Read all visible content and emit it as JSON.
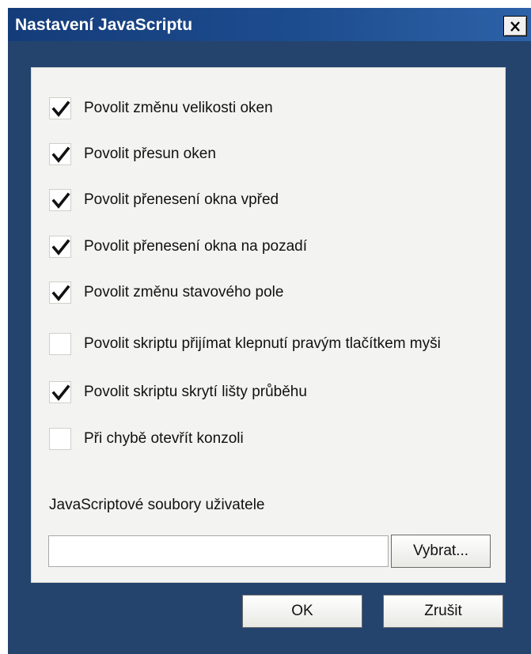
{
  "window": {
    "title": "Nastavení JavaScriptu"
  },
  "options": [
    {
      "label": "Povolit změnu velikosti oken",
      "checked": true
    },
    {
      "label": "Povolit přesun oken",
      "checked": true
    },
    {
      "label": "Povolit přenesení okna vpřed",
      "checked": true
    },
    {
      "label": "Povolit přenesení okna na pozadí",
      "checked": true
    },
    {
      "label": "Povolit změnu stavového pole",
      "checked": true
    },
    {
      "label": "Povolit skriptu přijímat klepnutí pravým tlačítkem myši",
      "checked": false
    },
    {
      "label": "Povolit skriptu skrytí lišty průběhu",
      "checked": true
    },
    {
      "label": "Při chybě otevřít konzoli",
      "checked": false
    }
  ],
  "files": {
    "label": "JavaScriptové soubory uživatele",
    "value": "",
    "button": "Vybrat..."
  },
  "buttons": {
    "ok": "OK",
    "cancel": "Zrušit"
  },
  "colors": {
    "title_bar": "#1d4c8e",
    "background": "#24446e",
    "panel": "#f3f3f1"
  }
}
